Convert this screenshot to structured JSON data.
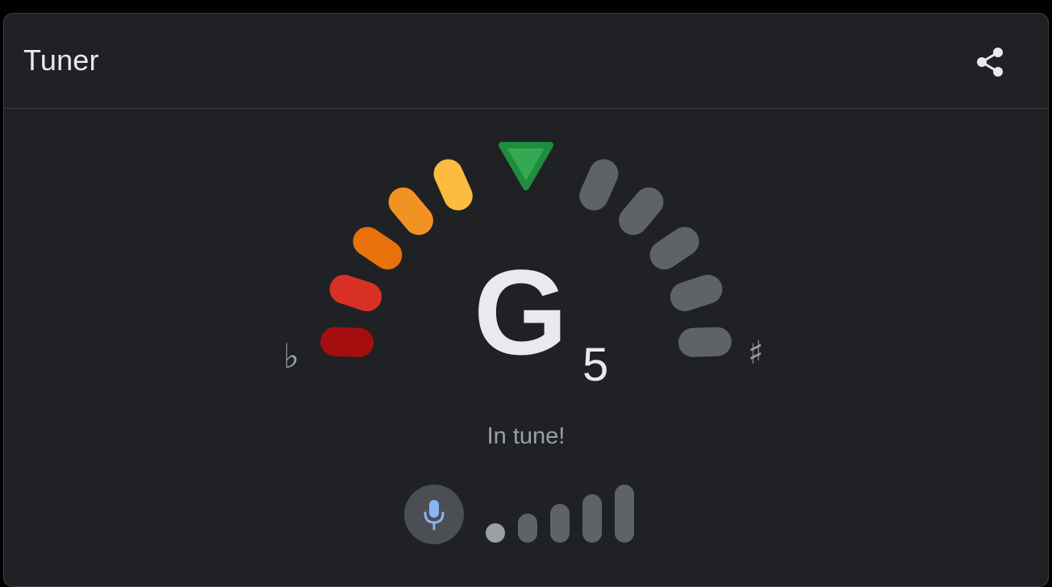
{
  "header": {
    "title": "Tuner",
    "share_icon": "share-icon"
  },
  "tuner": {
    "note": "G",
    "octave": "5",
    "flat_symbol": "♭",
    "sharp_symbol": "♯",
    "status": "In tune!",
    "pitch_offset": 0,
    "indicator_color": "#1e8e3e",
    "segment_colors_flat": [
      "#a50e0e",
      "#d93025",
      "#e8710a",
      "#f29222",
      "#fbbc3f"
    ],
    "segment_color_inactive": "#5f6368"
  },
  "input": {
    "mic_icon": "microphone-icon",
    "mic_color": "#8ab4f8",
    "level_bars": 5,
    "level_active": 1
  },
  "colors": {
    "background": "#202124",
    "text": "#e8eaed",
    "muted_text": "#9aa0a6"
  }
}
